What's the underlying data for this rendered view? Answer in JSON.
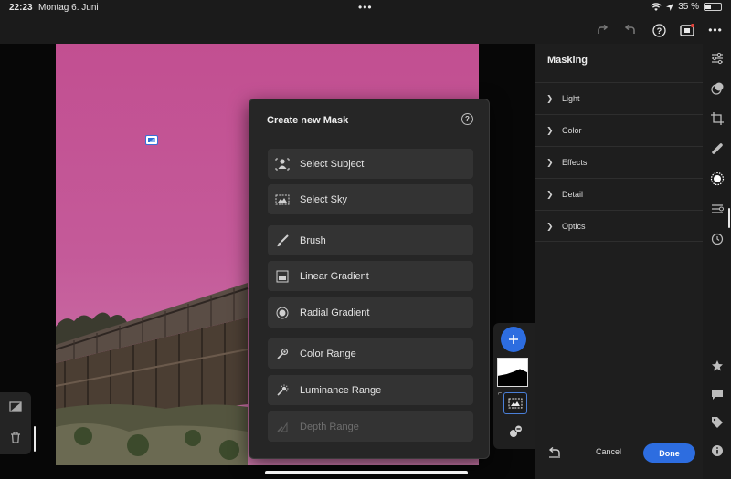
{
  "status": {
    "time": "22:23",
    "date": "Montag 6. Juni",
    "battery": "35 %",
    "battery_level": 0.35
  },
  "toolbar": {
    "icons": [
      "redo-icon",
      "undo-icon",
      "help-icon",
      "camera-icon",
      "more-icon"
    ]
  },
  "popup": {
    "title": "Create new Mask",
    "options": [
      {
        "label": "Select Subject",
        "icon": "select-subject-icon",
        "enabled": true
      },
      {
        "label": "Select Sky",
        "icon": "select-sky-icon",
        "enabled": true
      },
      {
        "label": "Brush",
        "icon": "brush-icon",
        "enabled": true
      },
      {
        "label": "Linear Gradient",
        "icon": "linear-gradient-icon",
        "enabled": true
      },
      {
        "label": "Radial Gradient",
        "icon": "radial-gradient-icon",
        "enabled": true
      },
      {
        "label": "Color Range",
        "icon": "color-range-icon",
        "enabled": true
      },
      {
        "label": "Luminance Range",
        "icon": "luminance-range-icon",
        "enabled": true
      },
      {
        "label": "Depth Range",
        "icon": "depth-range-icon",
        "enabled": false
      }
    ]
  },
  "panel": {
    "title": "Masking",
    "sections": [
      "Light",
      "Color",
      "Effects",
      "Detail",
      "Optics"
    ],
    "cancel_label": "Cancel",
    "done_label": "Done"
  },
  "rail": {
    "icons": [
      "edit-sliders-icon",
      "presets-icon",
      "crop-icon",
      "healing-icon",
      "masking-icon",
      "versions-icon",
      "history-icon",
      "star-icon",
      "comment-icon",
      "tag-icon",
      "info-icon"
    ]
  },
  "colors": {
    "accent": "#2d6de0",
    "sky_mask_overlay": "#c24f91",
    "panel_bg": "#1e1e1e"
  }
}
